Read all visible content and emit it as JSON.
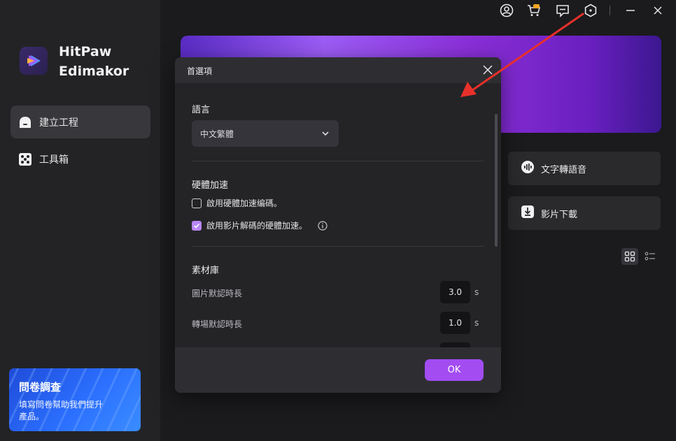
{
  "app": {
    "name_line1": "HitPaw",
    "name_line2": "Edimakor"
  },
  "sidebar": {
    "items": [
      {
        "label": "建立工程",
        "icon": "home-icon",
        "active": true
      },
      {
        "label": "工具箱",
        "icon": "dice-icon",
        "active": false
      }
    ],
    "survey": {
      "title": "問卷調查",
      "description": "填寫問卷幫助我們提升產品。"
    }
  },
  "topbar": {
    "icons": [
      "account-icon",
      "cart-icon",
      "feedback-icon",
      "settings-icon",
      "minimize-icon",
      "close-icon"
    ]
  },
  "main": {
    "cards": [
      {
        "label": "文字轉語音",
        "icon": "tts-icon"
      },
      {
        "label": "影片下載",
        "icon": "download-icon"
      }
    ]
  },
  "dialog": {
    "title": "首選項",
    "language": {
      "title": "語言",
      "selected": "中文繁體"
    },
    "hardware": {
      "title": "硬體加速",
      "options": [
        {
          "label": "啟用硬體加速编碼。",
          "checked": false
        },
        {
          "label": "啟用影片解碼的硬體加速。",
          "checked": true
        }
      ]
    },
    "library": {
      "title": "素材庫",
      "fields": [
        {
          "label": "圖片默認時長",
          "value": "3.0",
          "unit": "s"
        },
        {
          "label": "轉場默認時長",
          "value": "1.0",
          "unit": "s"
        }
      ]
    },
    "ok_label": "OK"
  },
  "colors": {
    "accent": "#a24cf2",
    "checkbox_checked": "#b985f5",
    "annotation_arrow": "#e8302a"
  }
}
